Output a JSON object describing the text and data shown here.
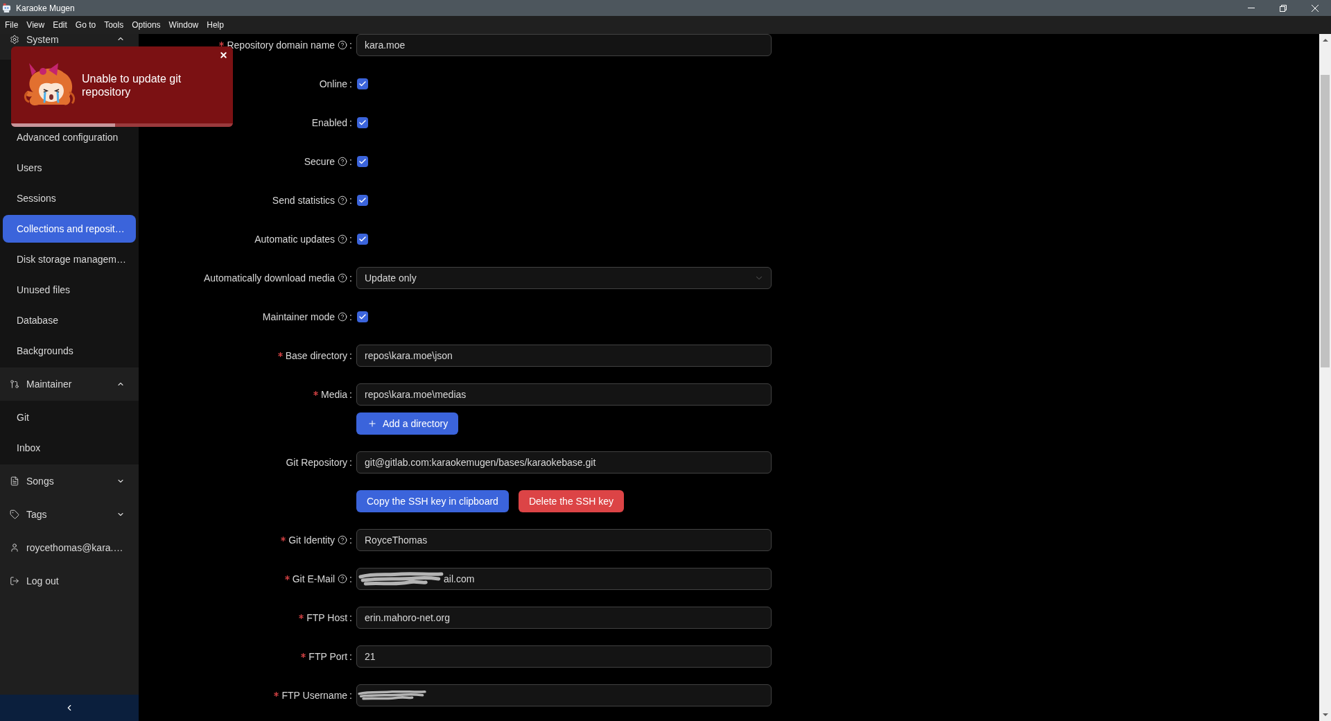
{
  "window": {
    "title": "Karaoke Mugen"
  },
  "menu_bar": [
    "File",
    "View",
    "Edit",
    "Go to",
    "Tools",
    "Options",
    "Window",
    "Help"
  ],
  "sidebar": {
    "groups": [
      {
        "label": "System",
        "expanded": true,
        "items": [
          {
            "label": "Advanced configuration",
            "selected": false
          },
          {
            "label": "Users",
            "selected": false
          },
          {
            "label": "Sessions",
            "selected": false
          },
          {
            "label": "Collections and reposit…",
            "selected": true
          },
          {
            "label": "Disk storage managem…",
            "selected": false
          },
          {
            "label": "Unused files",
            "selected": false
          },
          {
            "label": "Database",
            "selected": false
          },
          {
            "label": "Backgrounds",
            "selected": false
          }
        ]
      },
      {
        "label": "Maintainer",
        "expanded": true,
        "items": [
          {
            "label": "Git",
            "selected": false
          },
          {
            "label": "Inbox",
            "selected": false
          }
        ]
      },
      {
        "label": "Songs",
        "expanded": false
      },
      {
        "label": "Tags",
        "expanded": false
      }
    ],
    "links": [
      {
        "label": "roycethomas@kara.…"
      },
      {
        "label": "Log out"
      }
    ]
  },
  "notification": {
    "message": "Unable to update git repository",
    "level": 0.47
  },
  "form": {
    "rows": [
      {
        "kind": "text",
        "label": "Repository domain name",
        "required": true,
        "help": true,
        "colon": ":",
        "value": "kara.moe",
        "redacted": false
      },
      {
        "kind": "checkbox",
        "label": "Online",
        "required": false,
        "help": false,
        "colon": ":",
        "checked": true
      },
      {
        "kind": "checkbox",
        "label": "Enabled",
        "required": false,
        "help": false,
        "colon": ":",
        "checked": true
      },
      {
        "kind": "checkbox",
        "label": "Secure",
        "required": false,
        "help": true,
        "colon": ":",
        "checked": true
      },
      {
        "kind": "checkbox",
        "label": "Send statistics",
        "required": false,
        "help": true,
        "colon": ":",
        "checked": true
      },
      {
        "kind": "checkbox",
        "label": "Automatic updates",
        "required": false,
        "help": true,
        "colon": ":",
        "checked": true
      },
      {
        "kind": "select",
        "label": "Automatically download media",
        "required": false,
        "help": true,
        "colon": ":",
        "value": "Update only"
      },
      {
        "kind": "checkbox",
        "label": "Maintainer mode",
        "required": false,
        "help": true,
        "colon": ":",
        "checked": true
      },
      {
        "kind": "text",
        "label": "Base directory",
        "required": true,
        "help": false,
        "colon": ":",
        "value": "repos\\kara.moe\\json",
        "redacted": false
      },
      {
        "kind": "text",
        "label": "Media",
        "required": true,
        "help": false,
        "colon": ":",
        "value": "repos\\kara.moe\\medias",
        "redacted": false
      },
      {
        "kind": "add_button",
        "label": "Add a directory"
      },
      {
        "kind": "text",
        "label": "Git Repository",
        "required": false,
        "help": false,
        "colon": ":",
        "value": "git@gitlab.com:karaokemugen/bases/karaokebase.git",
        "redacted": false
      },
      {
        "kind": "button_row",
        "buttons": [
          {
            "kind": "primary",
            "label": "Copy the SSH key in clipboard"
          },
          {
            "kind": "danger",
            "label": "Delete the SSH key"
          }
        ]
      },
      {
        "kind": "text",
        "label": "Git Identity",
        "required": true,
        "help": true,
        "colon": ":",
        "value": "RoyceThomas",
        "redacted": false
      },
      {
        "kind": "text",
        "label": "Git E-Mail",
        "required": true,
        "help": true,
        "colon": ":",
        "value": "ail.com",
        "redacted": true
      },
      {
        "kind": "text",
        "label": "FTP Host",
        "required": true,
        "help": false,
        "colon": ":",
        "value": "erin.mahoro-net.org",
        "redacted": false
      },
      {
        "kind": "text",
        "label": "FTP Port",
        "required": true,
        "help": false,
        "colon": ":",
        "value": "21",
        "redacted": false
      },
      {
        "kind": "text",
        "label": "FTP Username",
        "required": true,
        "help": false,
        "colon": ":",
        "redacted": true
      }
    ]
  }
}
